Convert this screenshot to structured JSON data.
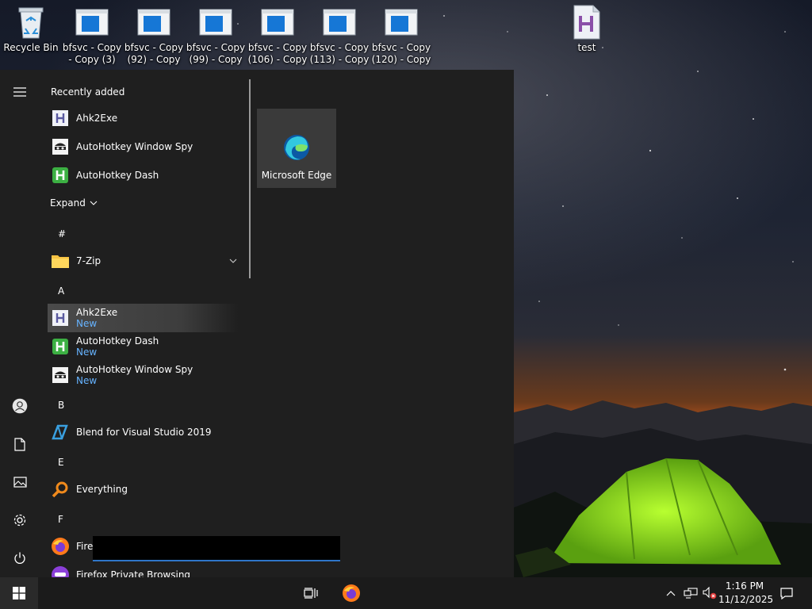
{
  "desktop": {
    "icons": [
      {
        "name": "recycle-bin",
        "label": "Recycle Bin",
        "icon": "recycle-bin-icon"
      },
      {
        "name": "bfsvc-copy-3",
        "label": "bfsvc - Copy\n- Copy (3)",
        "icon": "application-window-icon"
      },
      {
        "name": "bfsvc-copy-92",
        "label": "bfsvc - Copy\n(92) - Copy",
        "icon": "application-window-icon"
      },
      {
        "name": "bfsvc-copy-99",
        "label": "bfsvc - Copy\n(99) - Copy",
        "icon": "application-window-icon"
      },
      {
        "name": "bfsvc-copy-106",
        "label": "bfsvc - Copy\n(106) - Copy",
        "icon": "application-window-icon"
      },
      {
        "name": "bfsvc-copy-113",
        "label": "bfsvc - Copy\n(113) - Copy",
        "icon": "application-window-icon"
      },
      {
        "name": "bfsvc-copy-120",
        "label": "bfsvc - Copy\n(120) - Copy",
        "icon": "application-window-icon"
      },
      {
        "name": "test",
        "label": "test",
        "icon": "autohotkey-script-icon"
      }
    ]
  },
  "start_menu": {
    "rail": [
      "hamburger-menu-icon",
      "user-icon",
      "documents-icon",
      "pictures-icon",
      "settings-gear-icon",
      "power-icon"
    ],
    "recently_added_title": "Recently added",
    "recently_added": [
      "Ahk2Exe",
      "AutoHotkey Window Spy",
      "AutoHotkey Dash"
    ],
    "expand_label": "Expand",
    "groups": {
      "hash": "#",
      "a": "A",
      "b": "B",
      "e": "E",
      "f": "F"
    },
    "apps": {
      "zip": "7-Zip",
      "ahk2exe": "Ahk2Exe",
      "ahk_dash": "AutoHotkey Dash",
      "ahk_spy": "AutoHotkey Window Spy",
      "blend": "Blend for Visual Studio 2019",
      "everything": "Everything",
      "firefox": "Firef",
      "firefox_private": "Firefox Private Browsing"
    },
    "new_badge": "New",
    "tile": {
      "label": "Microsoft Edge",
      "icon": "microsoft-edge-icon"
    }
  },
  "taskbar": {
    "time": "1:16 PM",
    "date": "11/12/2025"
  },
  "colors": {
    "menu_bg": "#1f1f1f",
    "taskbar_bg": "#1b1b1b",
    "accent": "#2f76c8",
    "new_badge": "#66b3ff"
  }
}
